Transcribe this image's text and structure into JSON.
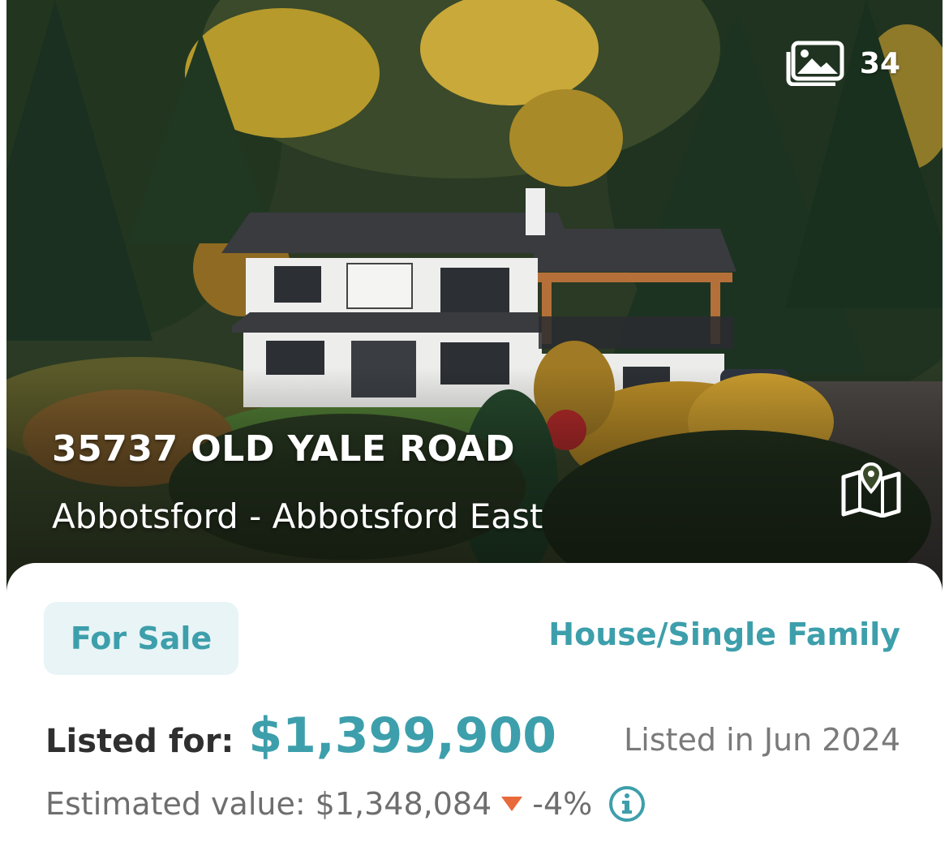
{
  "listing": {
    "photo_count": "34",
    "address": "35737 OLD YALE ROAD",
    "area": "Abbotsford - Abbotsford East",
    "status": "For Sale",
    "property_type": "House/Single Family",
    "listed_for_label": "Listed for:",
    "listed_price": "$1,399,900",
    "listed_date": "Listed in Jun 2024",
    "estimated_label": "Estimated value:",
    "estimated_value": "$1,348,084",
    "estimated_change": "-4%"
  },
  "icons": {
    "gallery": "photo-gallery-icon",
    "map": "map-pin-icon",
    "trend": "triangle-down-icon",
    "info": "info-icon"
  },
  "colors": {
    "accent": "#3d9fab",
    "badge_bg": "#e8f4f5",
    "down": "#e8693a",
    "text_dark": "#2f2f2f",
    "text_muted": "#6e6e6e"
  }
}
